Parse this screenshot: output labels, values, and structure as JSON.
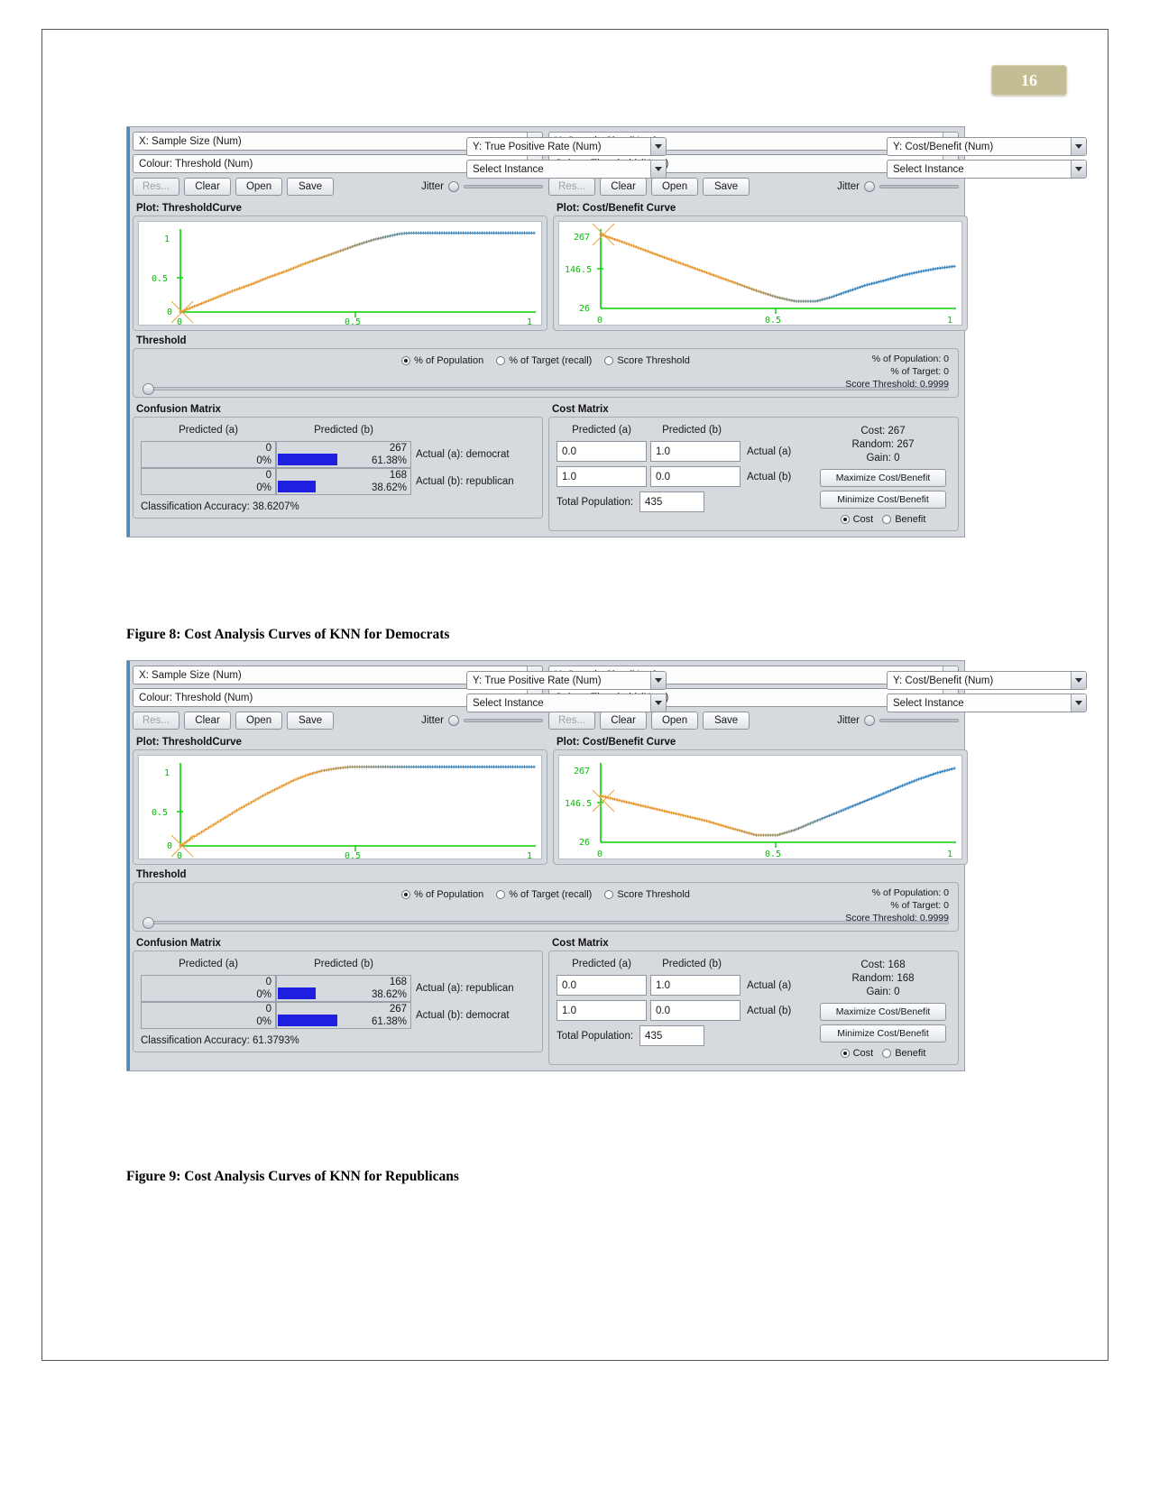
{
  "page": {
    "number": "16"
  },
  "figures": [
    {
      "id": "fig8",
      "caption": "Figure 8: Cost Analysis Curves of KNN for Democrats",
      "left_controls": {
        "x_combo": "X: Sample Size (Num)",
        "y_combo": "Y: True Positive Rate (Num)",
        "colour_combo": "Colour: Threshold (Num)",
        "instance_combo": "Select Instance",
        "reset_label": "Res...",
        "clear_label": "Clear",
        "open_label": "Open",
        "save_label": "Save",
        "jitter_label": "Jitter"
      },
      "right_controls": {
        "x_combo": "X: Sample Size (Num)",
        "y_combo": "Y: Cost/Benefit (Num)",
        "colour_combo": "Colour: Threshold (Num)",
        "instance_combo": "Select Instance",
        "reset_label": "Res...",
        "clear_label": "Clear",
        "open_label": "Open",
        "save_label": "Save",
        "jitter_label": "Jitter"
      },
      "left_plot_title": "Plot: ThresholdCurve",
      "right_plot_title": "Plot: Cost/Benefit Curve",
      "threshold": {
        "group_title": "Threshold",
        "radio_population": "% of Population",
        "radio_target": "% of Target (recall)",
        "radio_score": "Score Threshold",
        "readout_population": "% of Population: 0",
        "readout_target": "% of Target: 0",
        "readout_score": "Score Threshold: 0.9999"
      },
      "confusion": {
        "group_title": "Confusion Matrix",
        "col_a": "Predicted (a)",
        "col_b": "Predicted (b)",
        "rows": [
          {
            "a_num": "0",
            "a_pct": "0%",
            "b_num": "267",
            "b_pct": "61.38%",
            "b_bar": 61.38,
            "label": "Actual (a): democrat"
          },
          {
            "a_num": "0",
            "a_pct": "0%",
            "b_num": "168",
            "b_pct": "38.62%",
            "b_bar": 38.62,
            "label": "Actual (b): republican"
          }
        ],
        "accuracy": "Classification Accuracy:  38.6207%"
      },
      "cost": {
        "group_title": "Cost Matrix",
        "col_a": "Predicted (a)",
        "col_b": "Predicted (b)",
        "cell_aa": "0.0",
        "cell_ab": "1.0",
        "cell_ba": "1.0",
        "cell_bb": "0.0",
        "row_a_label": "Actual (a)",
        "row_b_label": "Actual (b)",
        "total_population_label": "Total Population:",
        "total_population_value": "435",
        "stat_cost": "Cost: 267",
        "stat_random": "Random: 267",
        "stat_gain": "Gain: 0",
        "maximize_label": "Maximize Cost/Benefit",
        "minimize_label": "Minimize Cost/Benefit",
        "radio_cost": "Cost",
        "radio_benefit": "Benefit"
      },
      "chart_data": [
        {
          "type": "scatter",
          "title": "Plot: ThresholdCurve",
          "xlabel": "Sample Size",
          "ylabel": "True Positive Rate",
          "xticks": [
            "0",
            "0.5",
            "1"
          ],
          "yticks": [
            "0",
            "0.5",
            "1"
          ],
          "xlim": [
            0,
            1
          ],
          "ylim": [
            0,
            1.05
          ],
          "grid": false,
          "colour_by": "Threshold",
          "shape": "concave-saturating",
          "points": [
            [
              0.0,
              0.0
            ],
            [
              0.05,
              0.09
            ],
            [
              0.1,
              0.18
            ],
            [
              0.15,
              0.27
            ],
            [
              0.2,
              0.35
            ],
            [
              0.25,
              0.44
            ],
            [
              0.3,
              0.52
            ],
            [
              0.35,
              0.61
            ],
            [
              0.4,
              0.69
            ],
            [
              0.45,
              0.77
            ],
            [
              0.5,
              0.85
            ],
            [
              0.55,
              0.92
            ],
            [
              0.6,
              0.97
            ],
            [
              0.62,
              0.99
            ],
            [
              0.65,
              1.0
            ],
            [
              0.7,
              1.0
            ],
            [
              0.8,
              1.0
            ],
            [
              0.9,
              1.0
            ],
            [
              1.0,
              1.0
            ]
          ]
        },
        {
          "type": "scatter",
          "title": "Plot: Cost/Benefit Curve",
          "xlabel": "Sample Size",
          "ylabel": "Cost/Benefit",
          "xticks": [
            "0",
            "0.5",
            "1"
          ],
          "yticks": [
            "26",
            "146.5",
            "267"
          ],
          "xlim": [
            0,
            1
          ],
          "ylim": [
            0,
            267
          ],
          "grid": false,
          "colour_by": "Threshold",
          "shape": "v-shaped",
          "points": [
            [
              0.0,
              267
            ],
            [
              0.05,
              245
            ],
            [
              0.1,
              222
            ],
            [
              0.15,
              198
            ],
            [
              0.2,
              175
            ],
            [
              0.25,
              152
            ],
            [
              0.3,
              129
            ],
            [
              0.35,
              106
            ],
            [
              0.4,
              83
            ],
            [
              0.45,
              60
            ],
            [
              0.5,
              40
            ],
            [
              0.55,
              26
            ],
            [
              0.61,
              26
            ],
            [
              0.65,
              40
            ],
            [
              0.7,
              62
            ],
            [
              0.75,
              84
            ],
            [
              0.8,
              100
            ],
            [
              0.85,
              118
            ],
            [
              0.9,
              132
            ],
            [
              0.95,
              144
            ],
            [
              1.0,
              152
            ]
          ]
        }
      ]
    },
    {
      "id": "fig9",
      "caption": "Figure 9: Cost Analysis Curves of KNN for Republicans",
      "left_controls": {
        "x_combo": "X: Sample Size (Num)",
        "y_combo": "Y: True Positive Rate (Num)",
        "colour_combo": "Colour: Threshold (Num)",
        "instance_combo": "Select Instance",
        "reset_label": "Res...",
        "clear_label": "Clear",
        "open_label": "Open",
        "save_label": "Save",
        "jitter_label": "Jitter"
      },
      "right_controls": {
        "x_combo": "X: Sample Size (Num)",
        "y_combo": "Y: Cost/Benefit (Num)",
        "colour_combo": "Colour: Threshold (Num)",
        "instance_combo": "Select Instance",
        "reset_label": "Res...",
        "clear_label": "Clear",
        "open_label": "Open",
        "save_label": "Save",
        "jitter_label": "Jitter"
      },
      "left_plot_title": "Plot: ThresholdCurve",
      "right_plot_title": "Plot: Cost/Benefit Curve",
      "threshold": {
        "group_title": "Threshold",
        "radio_population": "% of Population",
        "radio_target": "% of Target (recall)",
        "radio_score": "Score Threshold",
        "readout_population": "% of Population: 0",
        "readout_target": "% of Target: 0",
        "readout_score": "Score Threshold: 0.9999"
      },
      "confusion": {
        "group_title": "Confusion Matrix",
        "col_a": "Predicted (a)",
        "col_b": "Predicted (b)",
        "rows": [
          {
            "a_num": "0",
            "a_pct": "0%",
            "b_num": "168",
            "b_pct": "38.62%",
            "b_bar": 38.62,
            "label": "Actual (a): republican"
          },
          {
            "a_num": "0",
            "a_pct": "0%",
            "b_num": "267",
            "b_pct": "61.38%",
            "b_bar": 61.38,
            "label": "Actual (b): democrat"
          }
        ],
        "accuracy": "Classification Accuracy:  61.3793%"
      },
      "cost": {
        "group_title": "Cost Matrix",
        "col_a": "Predicted (a)",
        "col_b": "Predicted (b)",
        "cell_aa": "0.0",
        "cell_ab": "1.0",
        "cell_ba": "1.0",
        "cell_bb": "0.0",
        "row_a_label": "Actual (a)",
        "row_b_label": "Actual (b)",
        "total_population_label": "Total Population:",
        "total_population_value": "435",
        "stat_cost": "Cost: 168",
        "stat_random": "Random: 168",
        "stat_gain": "Gain: 0",
        "maximize_label": "Maximize Cost/Benefit",
        "minimize_label": "Minimize Cost/Benefit",
        "radio_cost": "Cost",
        "radio_benefit": "Benefit"
      },
      "chart_data": [
        {
          "type": "scatter",
          "title": "Plot: ThresholdCurve",
          "xlabel": "Sample Size",
          "ylabel": "True Positive Rate",
          "xticks": [
            "0",
            "0.5",
            "1"
          ],
          "yticks": [
            "0",
            "0.5",
            "1"
          ],
          "xlim": [
            0,
            1
          ],
          "ylim": [
            0,
            1.05
          ],
          "grid": false,
          "colour_by": "Threshold",
          "shape": "concave-saturating-early",
          "points": [
            [
              0.0,
              0.0
            ],
            [
              0.04,
              0.12
            ],
            [
              0.08,
              0.23
            ],
            [
              0.12,
              0.34
            ],
            [
              0.16,
              0.45
            ],
            [
              0.2,
              0.55
            ],
            [
              0.24,
              0.65
            ],
            [
              0.28,
              0.74
            ],
            [
              0.32,
              0.83
            ],
            [
              0.36,
              0.9
            ],
            [
              0.4,
              0.95
            ],
            [
              0.44,
              0.98
            ],
            [
              0.48,
              1.0
            ],
            [
              0.55,
              1.0
            ],
            [
              0.65,
              1.0
            ],
            [
              0.75,
              1.0
            ],
            [
              0.85,
              1.0
            ],
            [
              1.0,
              1.0
            ]
          ]
        },
        {
          "type": "scatter",
          "title": "Plot: Cost/Benefit Curve",
          "xlabel": "Sample Size",
          "ylabel": "Cost/Benefit",
          "xticks": [
            "0",
            "0.5",
            "1"
          ],
          "yticks": [
            "26",
            "146.5",
            "267"
          ],
          "xlim": [
            0,
            1
          ],
          "ylim": [
            0,
            267
          ],
          "grid": false,
          "colour_by": "Threshold",
          "shape": "v-shaped-rising",
          "points": [
            [
              0.0,
              168
            ],
            [
              0.05,
              152
            ],
            [
              0.1,
              137
            ],
            [
              0.15,
              122
            ],
            [
              0.2,
              107
            ],
            [
              0.25,
              92
            ],
            [
              0.3,
              77
            ],
            [
              0.35,
              58
            ],
            [
              0.4,
              40
            ],
            [
              0.44,
              26
            ],
            [
              0.5,
              26
            ],
            [
              0.55,
              45
            ],
            [
              0.6,
              72
            ],
            [
              0.65,
              98
            ],
            [
              0.7,
              124
            ],
            [
              0.75,
              150
            ],
            [
              0.8,
              176
            ],
            [
              0.85,
              203
            ],
            [
              0.9,
              228
            ],
            [
              0.95,
              250
            ],
            [
              1.0,
              267
            ]
          ]
        }
      ]
    }
  ]
}
